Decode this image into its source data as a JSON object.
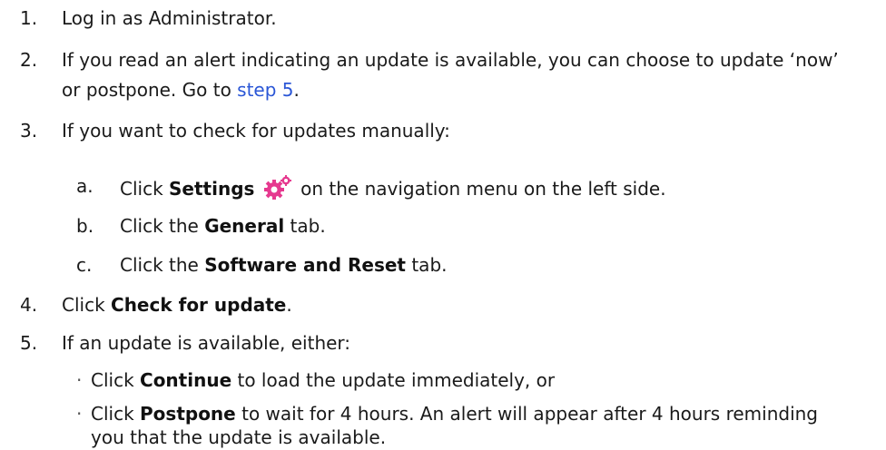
{
  "steps": [
    {
      "number": "1.",
      "text": "Log in as Administrator."
    },
    {
      "number": "2.",
      "text_line1": "If you read an alert indicating an update is available, you can choose to update ‘now’",
      "text_line2_prefix": "or postpone. Go to ",
      "link_text": "step 5",
      "text_line2_suffix": "."
    },
    {
      "number": "3.",
      "text": "If you want to check for updates manually:"
    },
    {
      "number": "4.",
      "prefix": "Click ",
      "bold": "Check for update",
      "suffix": "."
    },
    {
      "number": "5.",
      "text": "If an update is available, either:"
    }
  ],
  "substeps": [
    {
      "letter": "a.",
      "prefix": "Click ",
      "bold": "Settings",
      "icon": "settings-gear-icon",
      "suffix": " on the navigation menu on the left side."
    },
    {
      "letter": "b.",
      "prefix": "Click the ",
      "bold": "General",
      "suffix": " tab."
    },
    {
      "letter": "c.",
      "prefix": "Click the ",
      "bold": "Software and Reset",
      "suffix": " tab."
    }
  ],
  "bullets": [
    {
      "symbol": "·",
      "prefix": "Click ",
      "bold": "Continue",
      "suffix": " to load the update immediately, or"
    },
    {
      "symbol": "·",
      "prefix": "Click ",
      "bold": "Postpone",
      "suffix_line1": " to wait for 4 hours. An alert will appear after 4 hours reminding",
      "line2": "you that the update is available."
    }
  ],
  "colors": {
    "link": "#2a56d6",
    "icon": "#e6398f"
  }
}
